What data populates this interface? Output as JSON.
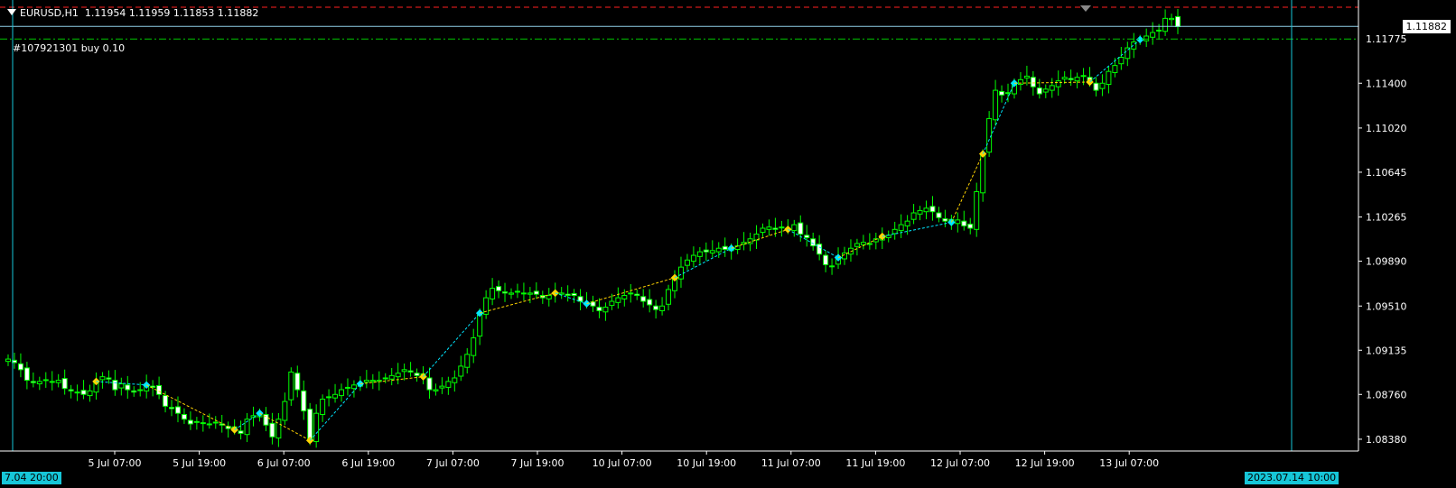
{
  "header": {
    "symbol_timeframe": "EURUSD,H1",
    "ohlc": "1.11954 1.11959 1.11853 1.11882"
  },
  "order": {
    "label": "#107921301 buy 0.10"
  },
  "price_axis": {
    "labels": [
      "1.11400",
      "1.11020",
      "1.10645",
      "1.10265",
      "1.09890",
      "1.09510",
      "1.09135",
      "1.08760",
      "1.08380"
    ],
    "bid_price": "1.11882",
    "order_price": "1.11775"
  },
  "time_axis": {
    "labels": [
      "5 Jul 07:00",
      "5 Jul 19:00",
      "6 Jul 07:00",
      "6 Jul 19:00",
      "7 Jul 07:00",
      "7 Jul 19:00",
      "10 Jul 07:00",
      "10 Jul 19:00",
      "11 Jul 07:00",
      "11 Jul 19:00",
      "12 Jul 07:00",
      "12 Jul 19:00",
      "13 Jul 07:00"
    ],
    "start_tag": "7.04 20:00",
    "cursor_tag": "2023.07.14 10:00"
  },
  "colors": {
    "background": "#000000",
    "bull_candle": "#00ff00",
    "bear_candle": "#ffffff",
    "grid_cursor": "#16c6d8",
    "order_line": "#00c800",
    "bid_line": "#8fd0e8",
    "stop_line": "#ff2020",
    "trade_buy": "#00e6ff",
    "trade_sell": "#ffd400"
  },
  "chart_data": {
    "type": "candlestick",
    "symbol": "EURUSD",
    "timeframe": "H1",
    "x_range": [
      "2023-07-04 20:00",
      "2023-07-14 10:00"
    ],
    "y_range": [
      1.0828,
      1.1206
    ],
    "closes": [
      1.0906,
      1.0903,
      1.0897,
      1.0888,
      1.0886,
      1.0887,
      1.0888,
      1.0887,
      1.0888,
      1.0881,
      1.0879,
      1.0878,
      1.0876,
      1.0879,
      1.0887,
      1.0891,
      1.0889,
      1.088,
      1.0885,
      1.088,
      1.0878,
      1.088,
      1.0884,
      1.0882,
      1.0876,
      1.0866,
      1.0864,
      1.086,
      1.0855,
      1.0851,
      1.0853,
      1.0852,
      1.0851,
      1.0852,
      1.085,
      1.0847,
      1.0846,
      1.0843,
      1.0855,
      1.0858,
      1.086,
      1.085,
      1.084,
      1.0855,
      1.087,
      1.0895,
      1.088,
      1.0862,
      1.0837,
      1.086,
      1.0872,
      1.0874,
      1.0876,
      1.088,
      1.0882,
      1.0884,
      1.0885,
      1.0888,
      1.0888,
      1.0888,
      1.089,
      1.0892,
      1.0894,
      1.0897,
      1.0895,
      1.0892,
      1.0891,
      1.088,
      1.088,
      1.0883,
      1.0887,
      1.089,
      1.09,
      1.091,
      1.0924,
      1.0945,
      1.0958,
      1.0966,
      1.0964,
      1.0962,
      1.0962,
      1.0963,
      1.0962,
      1.0962,
      1.0961,
      1.0958,
      1.096,
      1.0962,
      1.0962,
      1.096,
      1.096,
      1.0955,
      1.0953,
      1.0951,
      1.0947,
      1.095,
      1.0955,
      1.0958,
      1.096,
      1.0962,
      1.096,
      1.0955,
      1.0952,
      1.0948,
      1.0951,
      1.0965,
      1.0975,
      1.0984,
      1.099,
      1.0994,
      1.0997,
      1.0997,
      1.0998,
      1.1,
      1.0999,
      1.1,
      1.1002,
      1.1005,
      1.1008,
      1.1012,
      1.1017,
      1.1018,
      1.1016,
      1.1018,
      1.1016,
      1.102,
      1.1012,
      1.1009,
      1.1002,
      1.0995,
      1.0986,
      1.0985,
      1.0992,
      1.0996,
      1.1,
      1.1004,
      1.1005,
      1.1004,
      1.1008,
      1.101,
      1.1011,
      1.1016,
      1.102,
      1.1023,
      1.103,
      1.1032,
      1.1034,
      1.1031,
      1.1026,
      1.1023,
      1.1022,
      1.1024,
      1.1019,
      1.1017,
      1.1048,
      1.108,
      1.111,
      1.1134,
      1.113,
      1.1132,
      1.114,
      1.1143,
      1.1146,
      1.1137,
      1.1131,
      1.1135,
      1.1138,
      1.1142,
      1.1145,
      1.1143,
      1.1145,
      1.1146,
      1.1141,
      1.1134,
      1.114,
      1.115,
      1.1155,
      1.1162,
      1.117,
      1.1175,
      1.1177,
      1.118,
      1.1183,
      1.1185,
      1.1195,
      1.1195,
      1.1188
    ]
  }
}
